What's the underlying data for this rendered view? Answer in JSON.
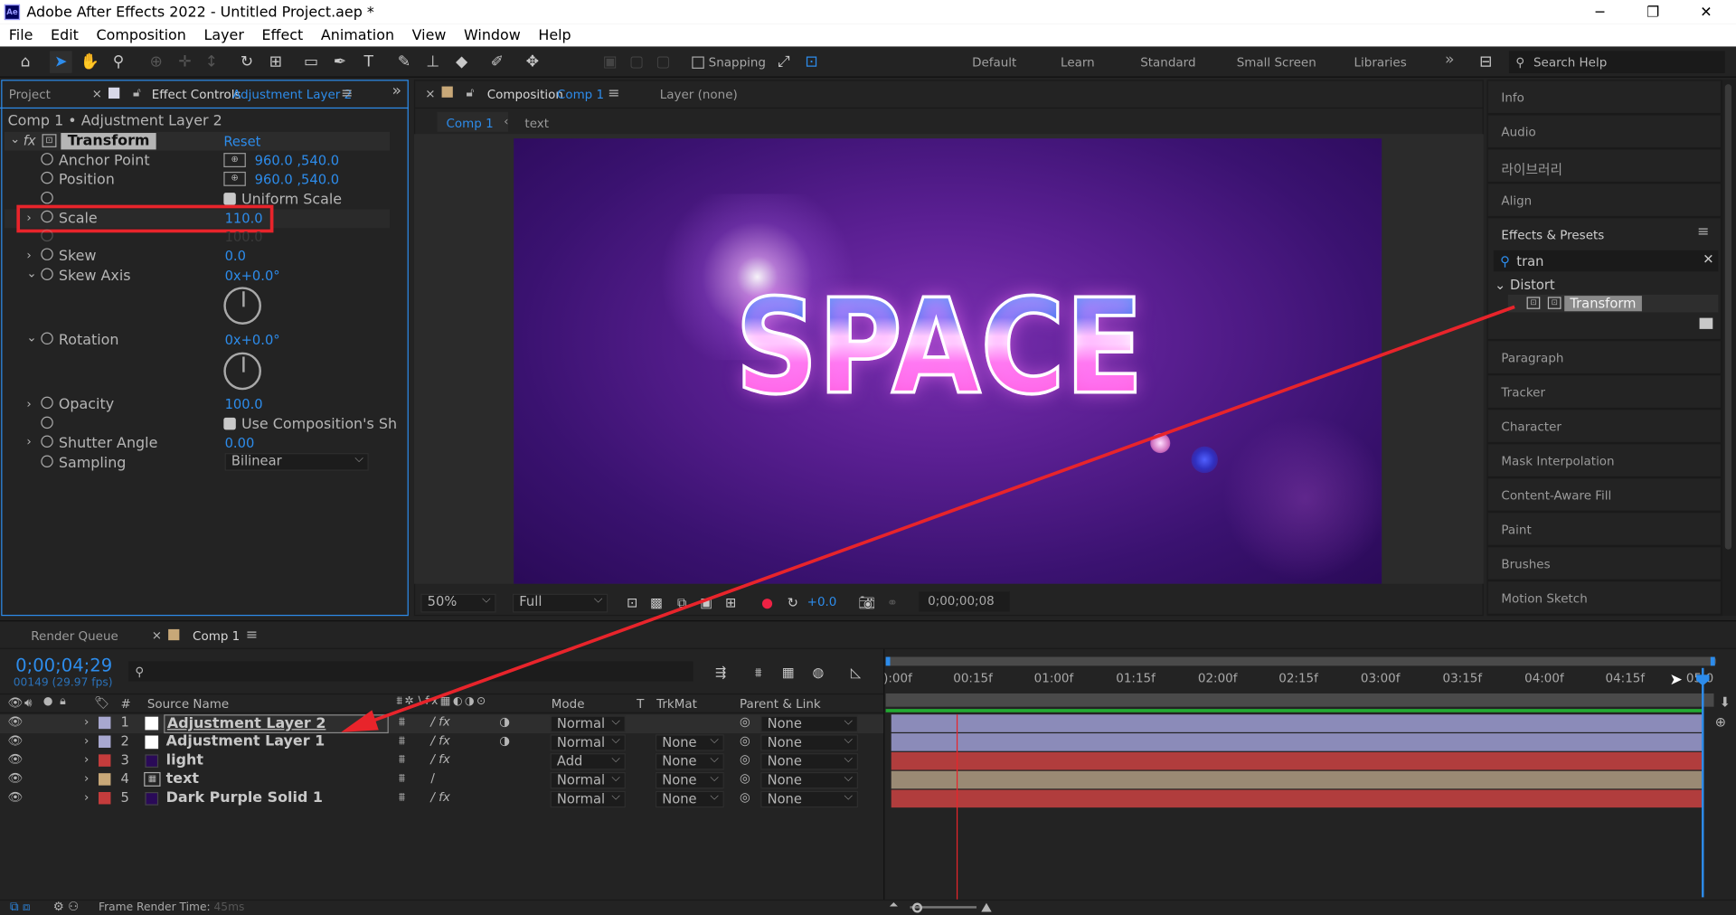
{
  "window": {
    "title": "Adobe After Effects 2022 - Untitled Project.aep *",
    "logo": "Ae",
    "minimize": "─",
    "restore": "❐",
    "close": "✕"
  },
  "menu": [
    "File",
    "Edit",
    "Composition",
    "Layer",
    "Effect",
    "Animation",
    "View",
    "Window",
    "Help"
  ],
  "toolbar": {
    "snapping": "Snapping",
    "workspaces": [
      "Default",
      "Learn",
      "Standard",
      "Small Screen",
      "Libraries"
    ],
    "more": "»",
    "search_placeholder": "Search Help"
  },
  "left_panel": {
    "project_tab": "Project",
    "effect_tab": "Effect Controls",
    "effect_tab_layer": "Adjustment Layer 2",
    "breadcrumb": "Comp 1 • Adjustment Layer 2",
    "effect": {
      "fx": "fx",
      "name": "Transform",
      "reset": "Reset"
    },
    "props": {
      "anchor_label": "Anchor Point",
      "anchor_value": "960.0 ,540.0",
      "position_label": "Position",
      "position_value": "960.0 ,540.0",
      "uniform_label": "Uniform Scale",
      "scale_label": "Scale",
      "scale_value": "110.0",
      "hidden_value": "100.0",
      "skew_label": "Skew",
      "skew_value": "0.0",
      "skew_axis_label": "Skew Axis",
      "skew_axis_value": "0x+0.0°",
      "rotation_label": "Rotation",
      "rotation_value": "0x+0.0°",
      "opacity_label": "Opacity",
      "opacity_value": "100.0",
      "use_comp_label": "Use Composition's Sh",
      "shutter_label": "Shutter Angle",
      "shutter_value": "0.00",
      "sampling_label": "Sampling",
      "sampling_value": "Bilinear"
    }
  },
  "comp_panel": {
    "tab": "Composition",
    "tab_comp": "Comp 1",
    "layer_tab": "Layer (none)",
    "flow": [
      "Comp 1",
      "text"
    ],
    "title_text": "SPACE",
    "zoom": "50%",
    "quality": "Full",
    "exposure": "+0.0",
    "timecode": "0;00;00;08"
  },
  "right_panel": {
    "items_top": [
      "Info",
      "Audio",
      "라이브러리",
      "Align"
    ],
    "effects_title": "Effects & Presets",
    "search_value": "tran",
    "category": "Distort",
    "effect_item": "Transform",
    "items_bottom": [
      "Paragraph",
      "Tracker",
      "Character",
      "Mask Interpolation",
      "Content-Aware Fill",
      "Paint",
      "Brushes",
      "Motion Sketch"
    ]
  },
  "timeline": {
    "render_tab": "Render Queue",
    "comp_tab": "Comp 1",
    "timecode": "0;00;04;29",
    "frames": "00149 (29.97 fps)",
    "search_placeholder": "",
    "headers": {
      "hash": "#",
      "source": "Source Name",
      "mode": "Mode",
      "t": "T",
      "trkmat": "TrkMat",
      "parent": "Parent & Link"
    },
    "ticks": [
      "):00f",
      "00:15f",
      "01:00f",
      "01:15f",
      "02:00f",
      "02:15f",
      "03:00f",
      "03:15f",
      "04:00f",
      "04:15f",
      "05:0"
    ],
    "layers": [
      {
        "num": "1",
        "name": "Adjustment Layer 2",
        "mode": "Normal",
        "trkmat": "",
        "parent": "None",
        "label": "#a8a8d0",
        "bar": "#9191c2"
      },
      {
        "num": "2",
        "name": "Adjustment Layer 1",
        "mode": "Normal",
        "trkmat": "None",
        "parent": "None",
        "label": "#a8a8d0",
        "bar": "#9191c2"
      },
      {
        "num": "3",
        "name": "light",
        "mode": "Add",
        "trkmat": "None",
        "parent": "None",
        "label": "#c43c3c",
        "bar": "#b13d3d"
      },
      {
        "num": "4",
        "name": "text",
        "mode": "Normal",
        "trkmat": "None",
        "parent": "None",
        "label": "#c8a878",
        "bar": "#9a8a74"
      },
      {
        "num": "5",
        "name": "Dark Purple Solid 1",
        "mode": "Normal",
        "trkmat": "None",
        "parent": "None",
        "label": "#c43c3c",
        "bar": "#b13d3d"
      }
    ],
    "render_time": "Frame Render Time:",
    "render_time_value": "45ms"
  },
  "colors": {
    "accent": "#2d8ceb",
    "highlight": "#e8242b",
    "panel": "#232323"
  }
}
